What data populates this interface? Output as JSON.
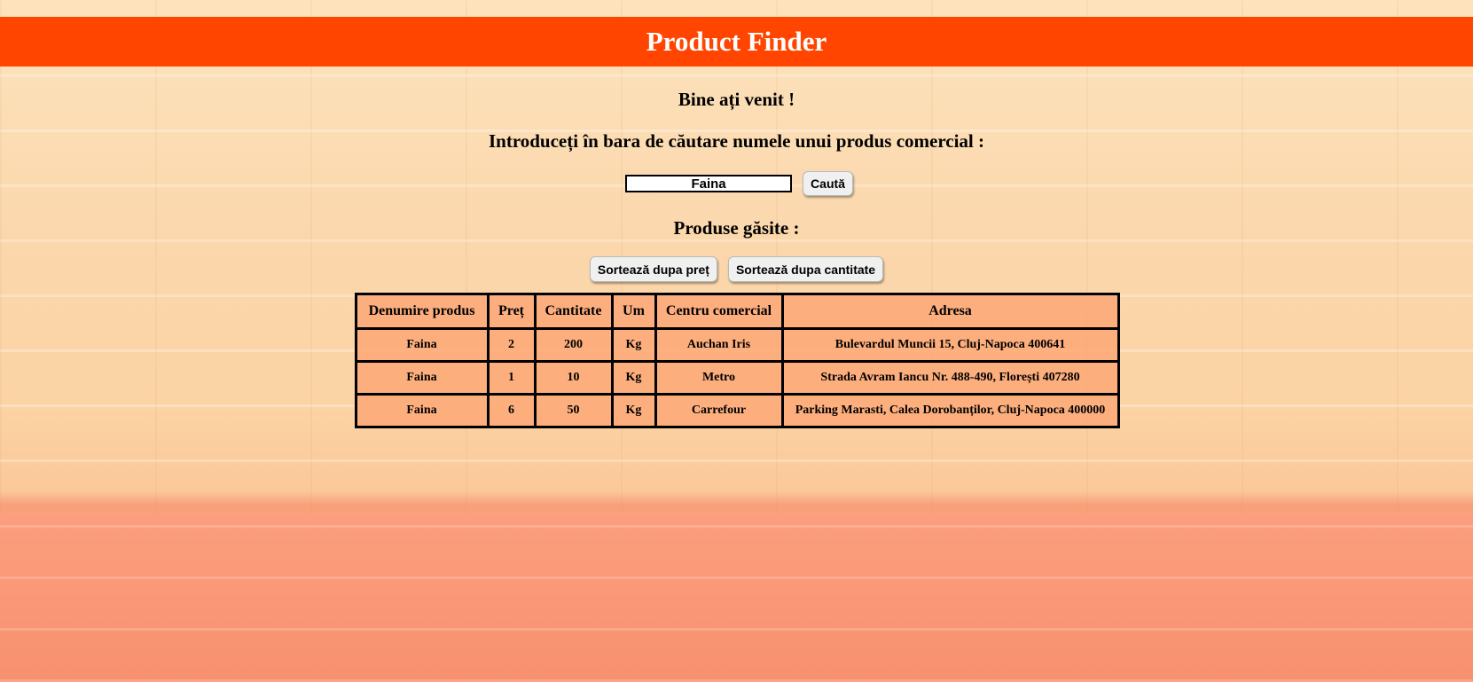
{
  "header": {
    "title": "Product Finder"
  },
  "main": {
    "welcome": "Bine ați venit !",
    "instructions": "Introduceți în bara de căutare numele unui produs comercial :",
    "search": {
      "value": "Faina",
      "button_label": "Caută"
    },
    "results_title": "Produse găsite :",
    "sort": {
      "by_price_label": "Sortează dupa preț",
      "by_quantity_label": "Sortează dupa cantitate"
    },
    "table": {
      "headers": [
        "Denumire produs",
        "Preț",
        "Cantitate",
        "Um",
        "Centru comercial",
        "Adresa"
      ],
      "rows": [
        [
          "Faina",
          "2",
          "200",
          "Kg",
          "Auchan Iris",
          "Bulevardul Muncii 15, Cluj-Napoca 400641"
        ],
        [
          "Faina",
          "1",
          "10",
          "Kg",
          "Metro",
          "Strada Avram Iancu Nr. 488-490, Florești 407280"
        ],
        [
          "Faina",
          "6",
          "50",
          "Kg",
          "Carrefour",
          "Parking Marasti, Calea Dorobanților, Cluj-Napoca 400000"
        ]
      ]
    }
  },
  "colors": {
    "header_bg": "#ff4500",
    "header_text": "#ffffff",
    "table_bg": "#fda878",
    "wall_top": "#fbd7ac",
    "wall_bottom": "#f8906f"
  }
}
